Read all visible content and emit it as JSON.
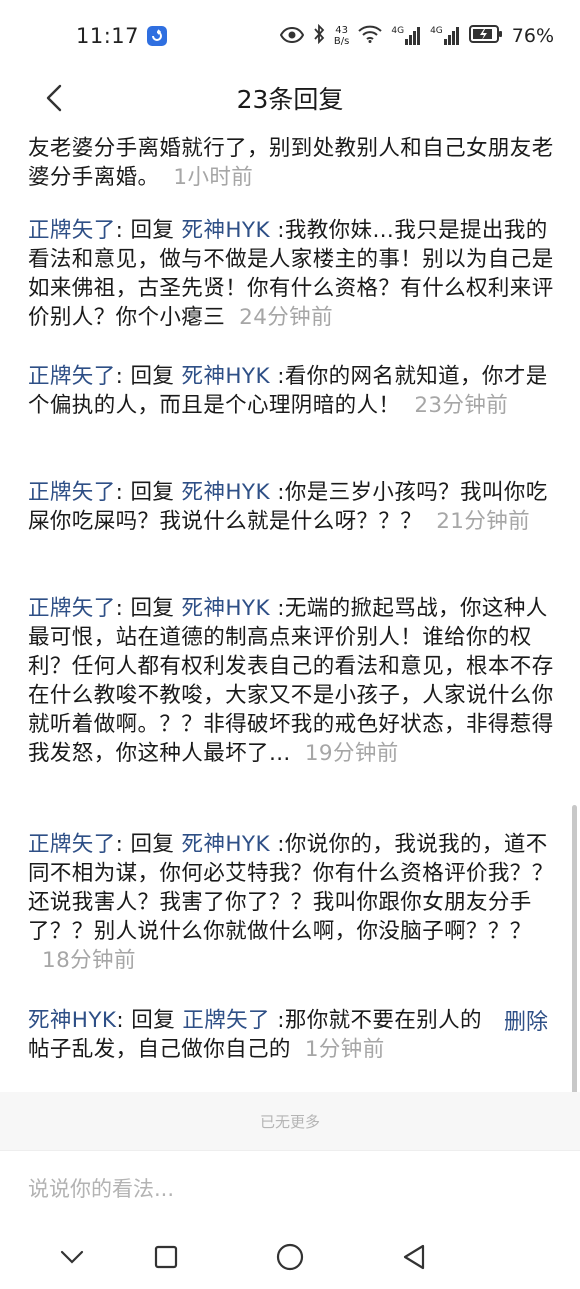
{
  "status_bar": {
    "time": "11:17",
    "net_speed_value": "43",
    "net_speed_unit": "B/s",
    "signal_1_label": "4G",
    "signal_2_label": "4G",
    "battery": "76%"
  },
  "header": {
    "title": "23条回复"
  },
  "comments": [
    {
      "author": "",
      "reply_label": "",
      "target": "",
      "text": "友老婆分手离婚就行了，别到处教别人和自己女朋友老婆分手离婚。",
      "time": "1小时前"
    },
    {
      "author": "正牌矢了",
      "reply_label": "回复",
      "target": "死神HYK",
      "text": ":我教你妹…我只是提出我的看法和意见，做与不做是人家楼主的事！别以为自己是如来佛祖，古圣先贤！你有什么资格？有什么权利来评价别人？你个小瘪三",
      "time": "24分钟前"
    },
    {
      "author": "正牌矢了",
      "reply_label": "回复",
      "target": "死神HYK",
      "text": ":看你的网名就知道，你才是个偏执的人，而且是个心理阴暗的人！",
      "time": "23分钟前"
    },
    {
      "author": "正牌矢了",
      "reply_label": "回复",
      "target": "死神HYK",
      "text": ":你是三岁小孩吗？我叫你吃屎你吃屎吗？我说什么就是什么呀？？？",
      "time": "21分钟前"
    },
    {
      "author": "正牌矢了",
      "reply_label": "回复",
      "target": "死神HYK",
      "text": ":无端的掀起骂战，你这种人最可恨，站在道德的制高点来评价别人！谁给你的权利？任何人都有权利发表自己的看法和意见，根本不存在什么教唆不教唆，大家又不是小孩子，人家说什么你就听着做啊。？？非得破坏我的戒色好状态，非得惹得我发怒，你这种人最坏了…",
      "time": "19分钟前"
    },
    {
      "author": "正牌矢了",
      "reply_label": "回复",
      "target": "死神HYK",
      "text": ":你说你的，我说我的，道不同不相为谋，你何必艾特我？你有什么资格评价我？？还说我害人？我害了你了？？我叫你跟你女朋友分手了？？别人说什么你就做什么啊，你没脑子啊？？？",
      "time": "18分钟前"
    },
    {
      "author": "死神HYK",
      "reply_label": "回复",
      "target": "正牌矢了",
      "text": ":那你就不要在别人的帖子乱发，自己做你自己的",
      "time": "1分钟前"
    }
  ],
  "delete_label": "删除",
  "no_more_text": "已无更多",
  "input": {
    "placeholder": "说说你的看法..."
  },
  "icons": {
    "back": "chevron-left-icon",
    "eye": "eye-icon",
    "bluetooth": "bluetooth-icon",
    "wifi": "wifi-icon",
    "signal": "signal-icon",
    "battery": "battery-icon",
    "nav_back": "triangle-back-icon",
    "nav_home": "circle-home-icon",
    "nav_recent": "square-recent-icon",
    "nav_hide": "chevron-down-icon"
  },
  "colors": {
    "username_link": "#2e4f86",
    "time_gray": "#a6a6a6",
    "no_more_band": "#f7f7f7"
  }
}
